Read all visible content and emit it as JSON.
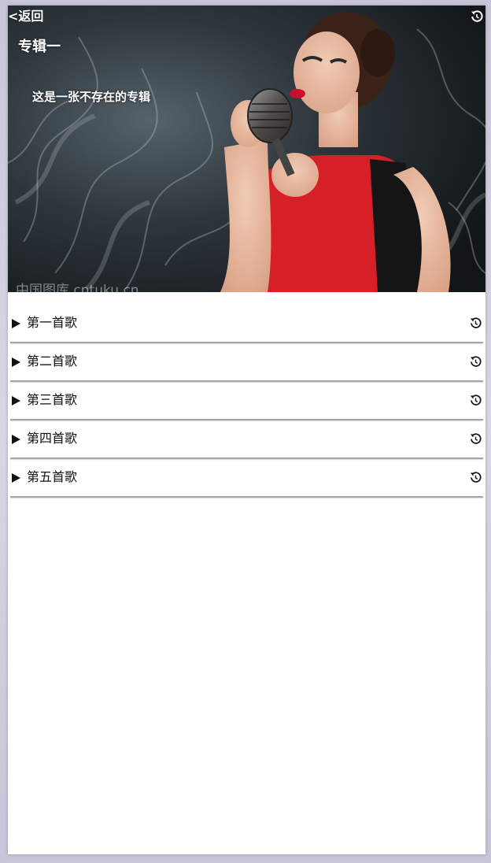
{
  "header": {
    "back_label": "<返回",
    "refresh_icon": "refresh-icon"
  },
  "album": {
    "title": "专辑一",
    "description": "这是一张不存在的专辑",
    "cover_watermark": "中国图库 cntuku.cn"
  },
  "songs": [
    {
      "name": "第一首歌"
    },
    {
      "name": "第二首歌"
    },
    {
      "name": "第三首歌"
    },
    {
      "name": "第四首歌"
    },
    {
      "name": "第五首歌"
    }
  ],
  "colors": {
    "dress": "#d61f26",
    "background_dark": "#1d2226",
    "divider": "#a6a6a6",
    "page_bg": "#ffffff"
  }
}
